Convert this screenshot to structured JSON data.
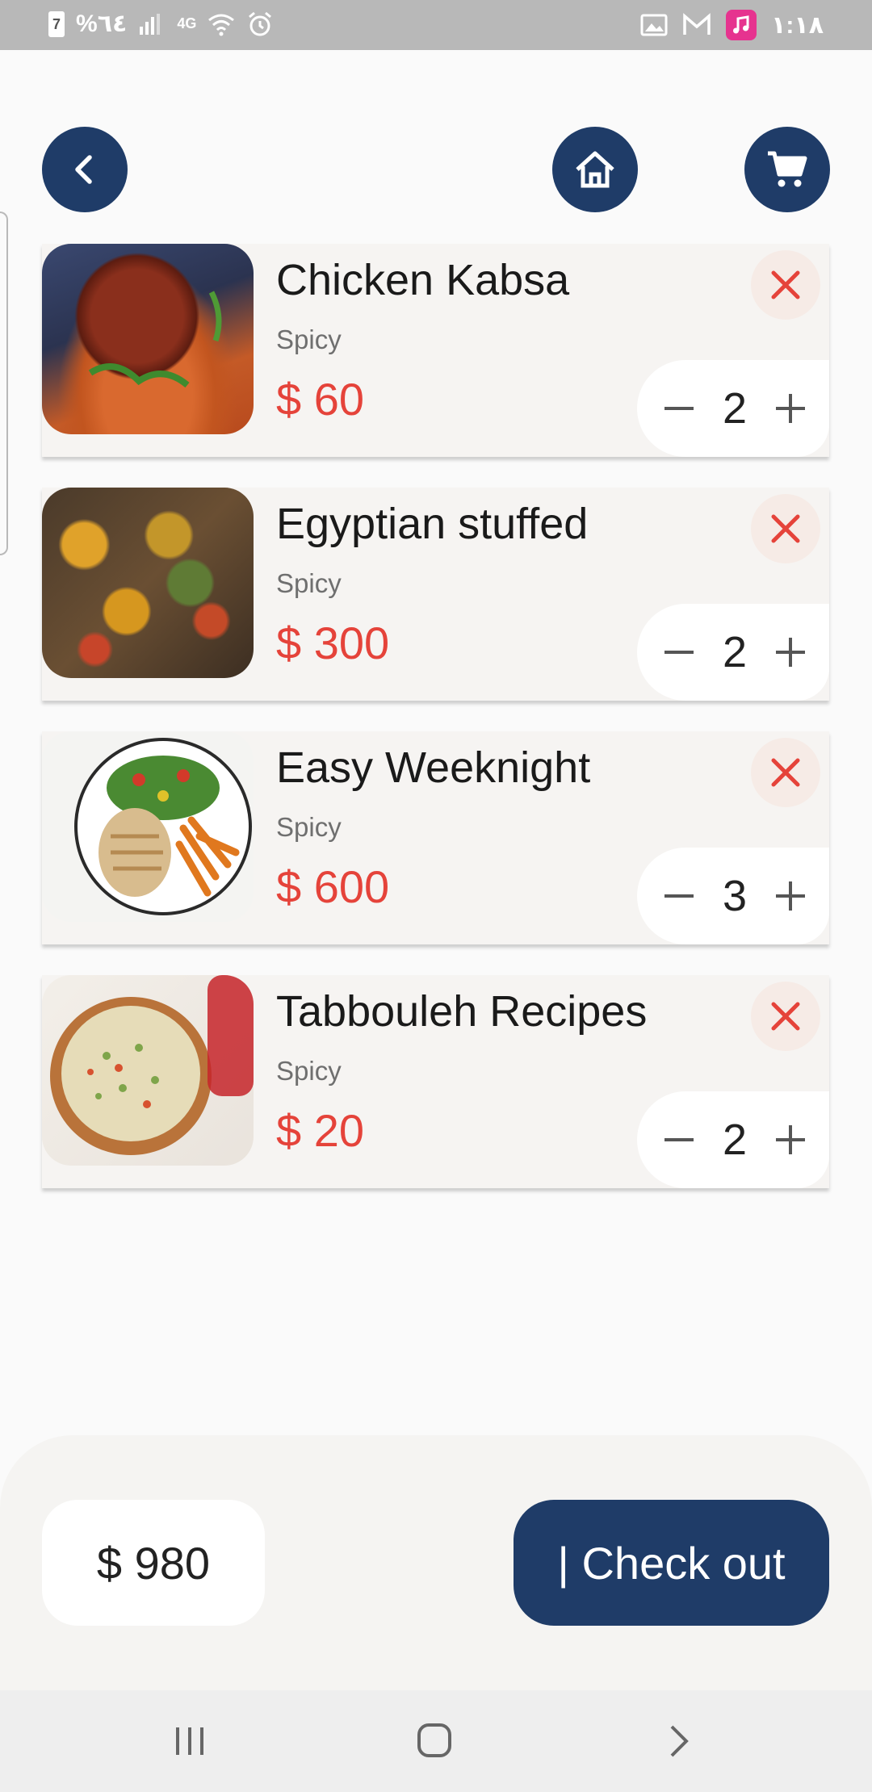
{
  "status_bar": {
    "battery_level_glyph": "7",
    "battery_text": "%٦٤",
    "signal_label": "4G",
    "time": "١:١٨"
  },
  "colors": {
    "primary_navy": "#1f3c68",
    "price_red": "#e5433a",
    "card_bg": "#f6f4f2",
    "page_bg": "#fafafa"
  },
  "header": {
    "back_icon": "chevron-left-icon",
    "home_icon": "home-icon",
    "cart_icon": "shopping-cart-icon"
  },
  "cart": {
    "items": [
      {
        "title": "Chicken Kabsa",
        "subtitle": "Spicy",
        "price": "$ 60",
        "quantity": "2",
        "image": "roast-chicken-kabsa-photo"
      },
      {
        "title": "Egyptian stuffed",
        "subtitle": "Spicy",
        "price": "$ 300",
        "quantity": "2",
        "image": "stuffed-vegetables-photo"
      },
      {
        "title": "Easy Weeknight",
        "subtitle": "Spicy",
        "price": "$ 600",
        "quantity": "3",
        "image": "chicken-salad-fries-plate-photo"
      },
      {
        "title": "Tabbouleh Recipes",
        "subtitle": "Spicy",
        "price": "$ 20",
        "quantity": "2",
        "image": "tabbouleh-bowl-photo"
      }
    ]
  },
  "footer": {
    "total": "$ 980",
    "checkout_label": "| Check out"
  }
}
